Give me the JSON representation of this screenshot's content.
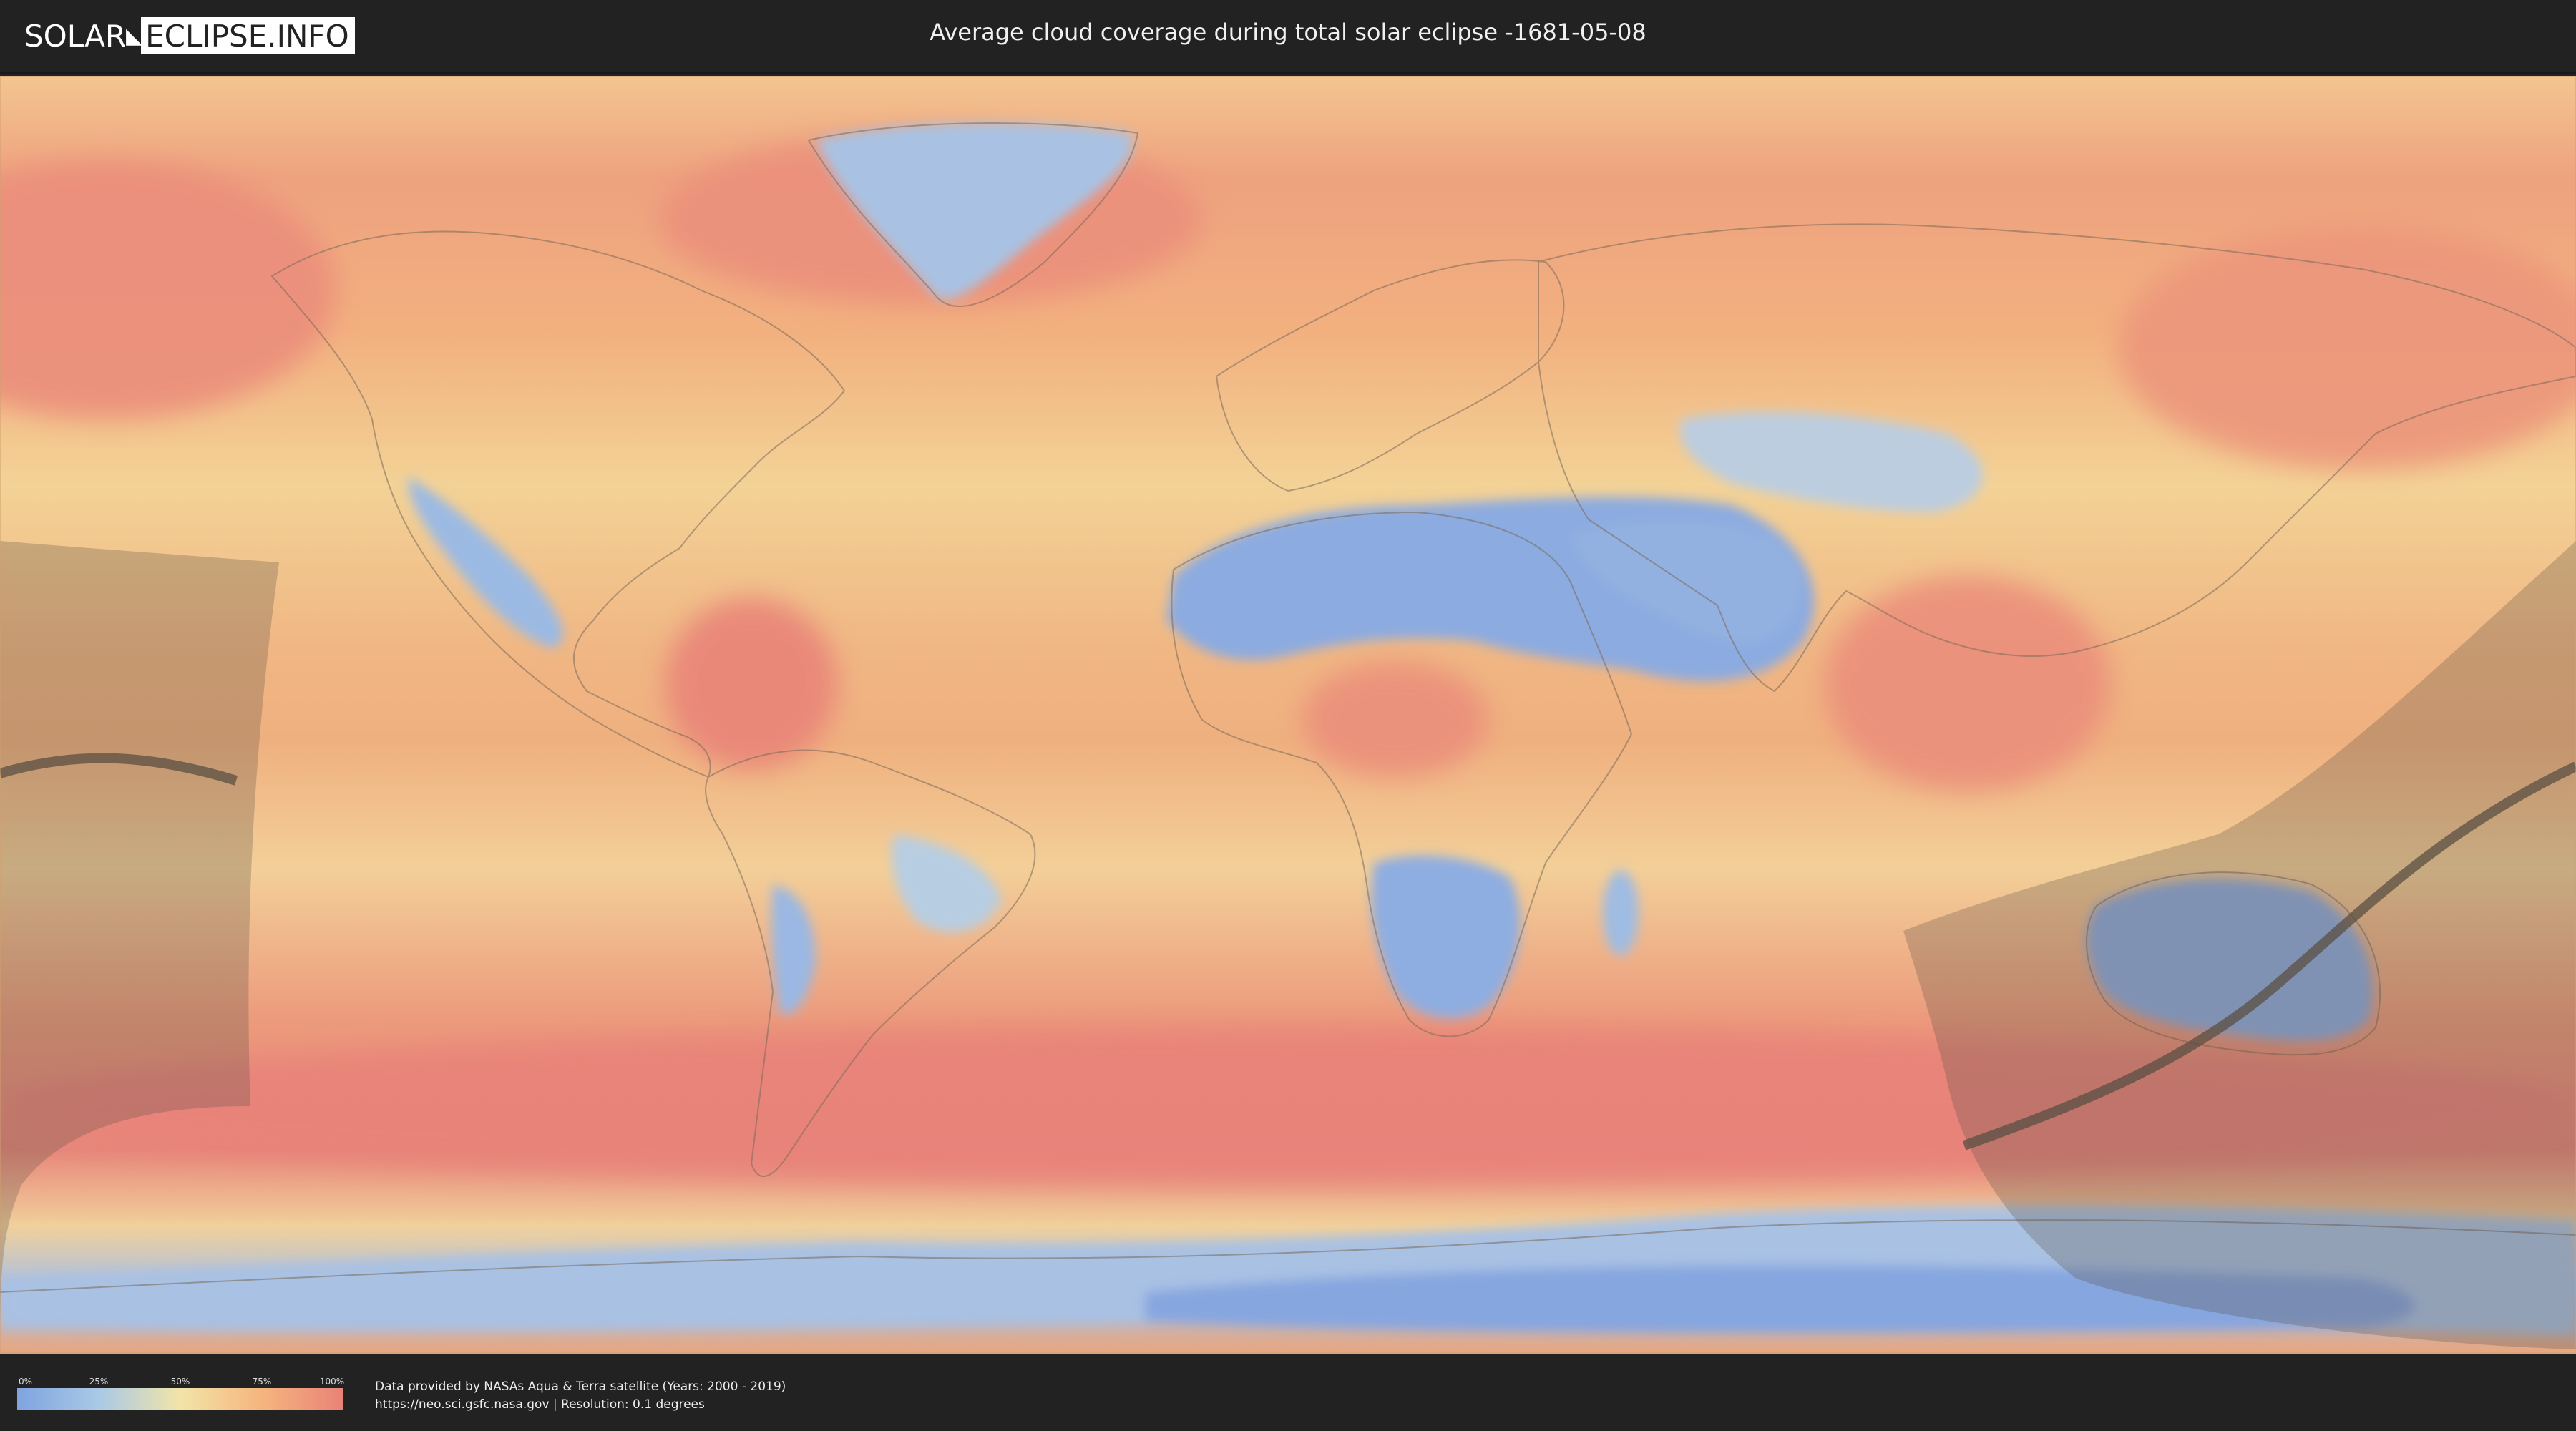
{
  "header": {
    "logo_left": "SOLAR",
    "logo_right": "ECLIPSE.INFO",
    "title": "Average cloud coverage during total solar eclipse -1681-05-08"
  },
  "map": {
    "projection": "equirectangular world map",
    "overlay": "eclipse visibility region with path of totality",
    "colors": {
      "clear": "#7fa4e0",
      "low": "#a9c9e6",
      "mid": "#f2e4a8",
      "high": "#f5b57e",
      "overcast": "#e98277",
      "eclipse_shadow": "#5a4f43"
    }
  },
  "legend": {
    "ticks": [
      "0%",
      "25%",
      "50%",
      "75%",
      "100%"
    ]
  },
  "credits": {
    "line1": "Data provided by NASAs Aqua & Terra satellite (Years: 2000 - 2019)",
    "line2": "https://neo.sci.gsfc.nasa.gov | Resolution: 0.1 degrees"
  }
}
